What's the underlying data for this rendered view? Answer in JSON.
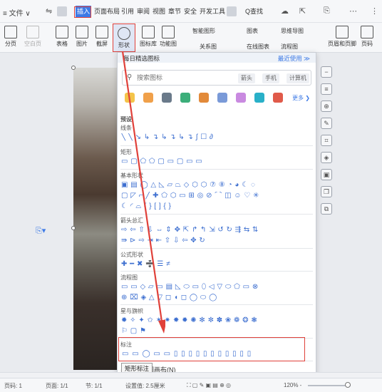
{
  "menubar": {
    "menu_label": "≡ 文件 ∨",
    "tabs": [
      "插入",
      "页面布局",
      "引用",
      "审阅",
      "视图",
      "章节",
      "安全",
      "开发工具"
    ],
    "active_tab": "插入",
    "search_label": "Q查找"
  },
  "ribbon": {
    "items": [
      "分页",
      "空白页",
      "表格",
      "图片",
      "截屏",
      "形状",
      "图标库",
      "功能图"
    ],
    "small_items": [
      "智能图形",
      "图表",
      "思维导图",
      "关系图",
      "在线图表",
      "流程图"
    ],
    "right_items": [
      "页眉和页脚",
      "页码"
    ]
  },
  "panel": {
    "header": "每日精选图标",
    "more_link": "最近使用 ≫",
    "search_placeholder": "搜索图标",
    "chips": [
      "箭头",
      "手机",
      "计算机"
    ],
    "icons_more": "更多 ❯",
    "sections": {
      "preset": "预设",
      "lines": "线条",
      "rect": "矩形",
      "basic": "基本形状",
      "arrows": "箭头总汇",
      "formula": "公式形状",
      "flow": "流程图",
      "stars": "星与旗帜",
      "callout": "标注"
    },
    "new_canvas": "新建绘图画布(N)",
    "tooltip": "矩形标注"
  },
  "status": {
    "pages": "页码: 1",
    "page_of": "页面: 1/1",
    "section": "节: 1/1",
    "setting": "设置值: 2.5厘米",
    "zoom": "120% -"
  },
  "colors": {
    "accent": "#3d7ae6",
    "highlight": "#e0413a"
  }
}
